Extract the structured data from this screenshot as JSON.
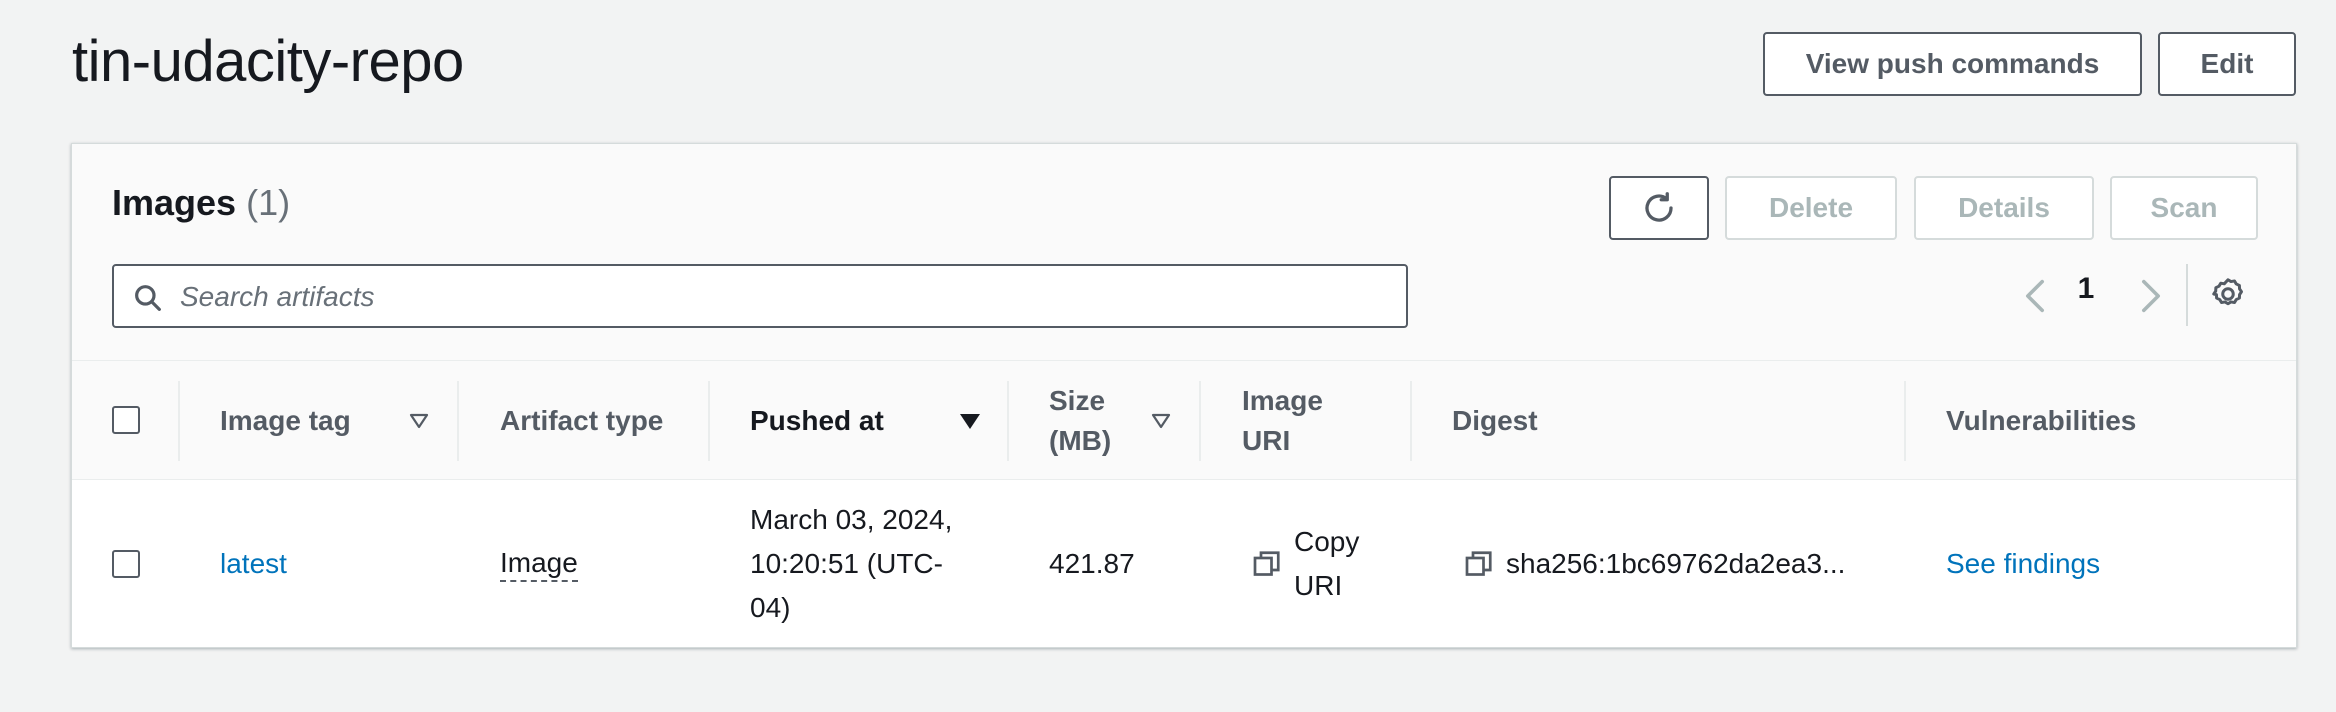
{
  "page": {
    "title": "tin-udacity-repo",
    "view_push_commands_label": "View push commands",
    "edit_label": "Edit"
  },
  "images_panel": {
    "heading": "Images",
    "count": "(1)",
    "refresh_icon": "refresh-icon",
    "delete_label": "Delete",
    "details_label": "Details",
    "scan_label": "Scan",
    "search": {
      "placeholder": "Search artifacts",
      "value": ""
    },
    "pagination": {
      "current_page": "1"
    }
  },
  "table": {
    "columns": [
      {
        "label": "Image tag",
        "sortable": true
      },
      {
        "label": "Artifact type",
        "sortable": false
      },
      {
        "label": "Pushed at",
        "sortable": true,
        "sorted": "descending"
      },
      {
        "label": "Size (MB)",
        "sortable": true
      },
      {
        "label": "Image URI",
        "sortable": false
      },
      {
        "label": "Digest",
        "sortable": false
      },
      {
        "label": "Vulnerabilities",
        "sortable": false
      }
    ],
    "rows": [
      {
        "image_tag": "latest",
        "artifact_type": "Image",
        "pushed_at": "March 03, 2024, 10:20:51 (UTC-04)",
        "size_mb": "421.87",
        "image_uri_action": "Copy URI",
        "digest": "sha256:1bc69762da2ea3...",
        "vulnerabilities": "See findings"
      }
    ]
  },
  "colors": {
    "background": "#f2f3f3",
    "link": "#0073bb",
    "text": "#16191f",
    "secondary_text": "#545b64",
    "disabled": "#aab7b8"
  }
}
